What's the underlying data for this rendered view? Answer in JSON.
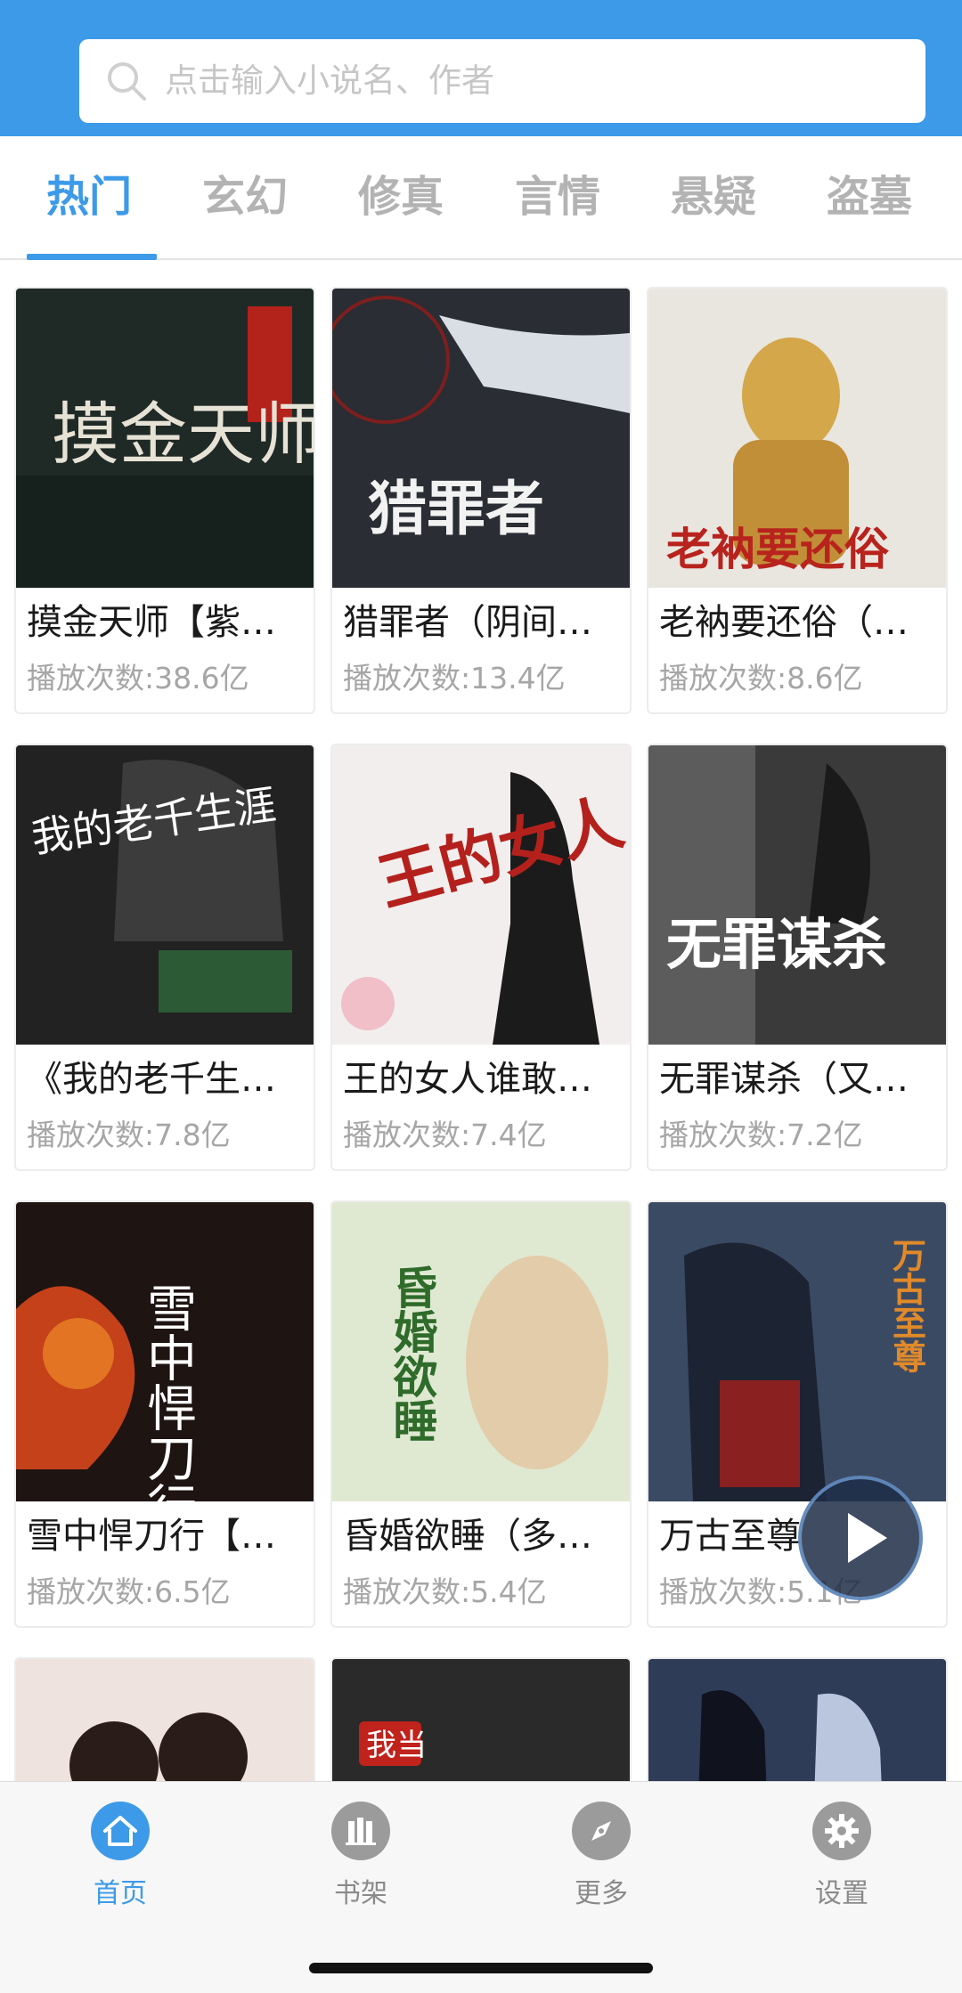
{
  "search": {
    "placeholder": "点击输入小说名、作者"
  },
  "tabs": [
    {
      "label": "热门",
      "active": true
    },
    {
      "label": "玄幻",
      "active": false
    },
    {
      "label": "修真",
      "active": false
    },
    {
      "label": "言情",
      "active": false
    },
    {
      "label": "悬疑",
      "active": false
    },
    {
      "label": "盗墓",
      "active": false
    }
  ],
  "books": [
    {
      "title": "摸金天师【紫…",
      "plays": "播放次数:38.6亿",
      "cover_text": "摸金天师",
      "cover_color": "#1f2a26"
    },
    {
      "title": "猎罪者（阴间…",
      "plays": "播放次数:13.4亿",
      "cover_text": "猎罪者",
      "cover_color": "#2a2d33"
    },
    {
      "title": "老衲要还俗（…",
      "plays": "播放次数:8.6亿",
      "cover_text": "老衲要还俗",
      "cover_color": "#e9e6df"
    },
    {
      "title": "《我的老千生…",
      "plays": "播放次数:7.8亿",
      "cover_text": "我的老千生涯",
      "cover_color": "#222222"
    },
    {
      "title": "王的女人谁敢…",
      "plays": "播放次数:7.4亿",
      "cover_text": "王的女人",
      "cover_color": "#f2eeee"
    },
    {
      "title": "无罪谋杀（又…",
      "plays": "播放次数:7.2亿",
      "cover_text": "无罪谋杀",
      "cover_color": "#3a3a3a"
    },
    {
      "title": "雪中悍刀行【…",
      "plays": "播放次数:6.5亿",
      "cover_text": "雪中悍刀行",
      "cover_color": "#1e1412"
    },
    {
      "title": "昏婚欲睡（多…",
      "plays": "播放次数:5.4亿",
      "cover_text": "昏婚欲睡",
      "cover_color": "#dfe9d2"
    },
    {
      "title": "万古至尊",
      "plays": "播放次数:5.1亿",
      "cover_text": "万古至尊",
      "cover_color": "#3b4a63"
    },
    {
      "title": "",
      "plays": "",
      "cover_text": "",
      "cover_color": "#efe3e0"
    },
    {
      "title": "",
      "plays": "",
      "cover_text": "我当",
      "cover_color": "#2a2a2a"
    },
    {
      "title": "",
      "plays": "",
      "cover_text": "",
      "cover_color": "#2f3c58"
    }
  ],
  "nav": [
    {
      "label": "首页",
      "icon": "home-icon",
      "active": true
    },
    {
      "label": "书架",
      "icon": "bookshelf-icon",
      "active": false
    },
    {
      "label": "更多",
      "icon": "compass-icon",
      "active": false
    },
    {
      "label": "设置",
      "icon": "gear-icon",
      "active": false
    }
  ],
  "colors": {
    "accent": "#3d9ae8",
    "muted": "#a6a6a6",
    "inactive_tab": "#b3b3b3"
  }
}
